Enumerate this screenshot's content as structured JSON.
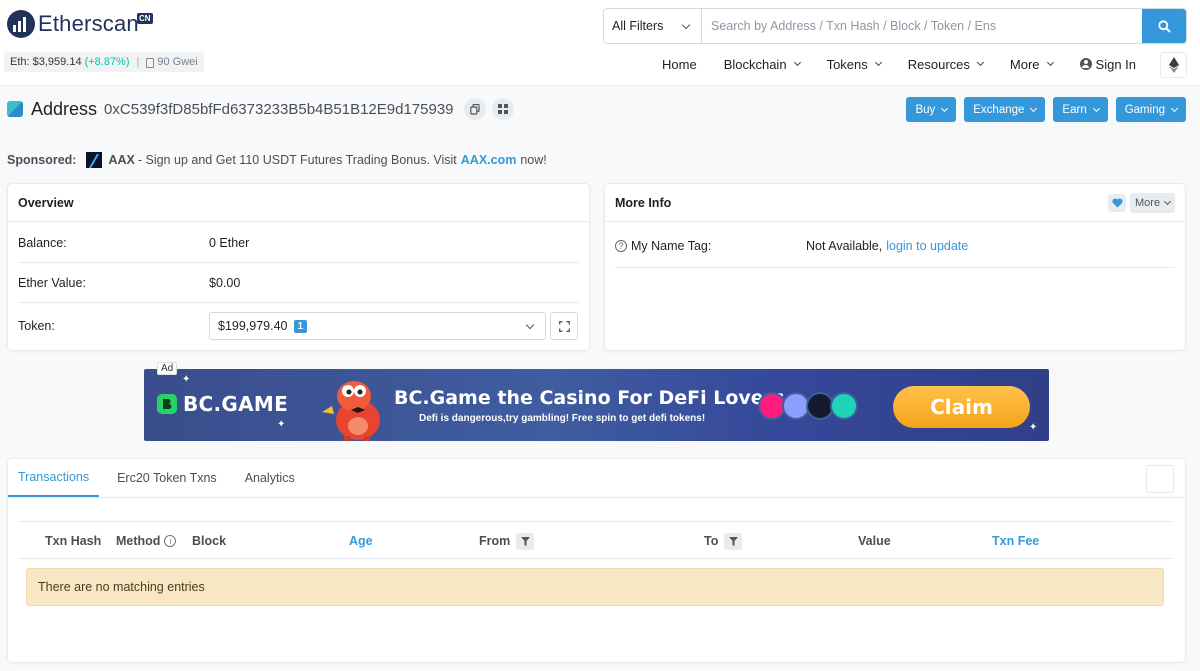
{
  "brand": {
    "name": "Etherscan",
    "cn_badge": "CN"
  },
  "eth_stats": {
    "price": "Eth: $3,959.14",
    "change": "(+8.87%)",
    "separator": "|",
    "gas": "90 Gwei"
  },
  "search": {
    "filter": "All Filters",
    "placeholder": "Search by Address / Txn Hash / Block / Token / Ens"
  },
  "nav": {
    "home": "Home",
    "blockchain": "Blockchain",
    "tokens": "Tokens",
    "resources": "Resources",
    "more": "More",
    "signin": "Sign In"
  },
  "address": {
    "label": "Address",
    "hash": "0xC539f3fD85bfFd6373233B5b4B51B12E9d175939"
  },
  "actions": {
    "buy": "Buy",
    "exchange": "Exchange",
    "earn": "Earn",
    "gaming": "Gaming"
  },
  "sponsored": {
    "label": "Sponsored:",
    "dash": "-",
    "name": "AAX",
    "text": "- Sign up and Get 110 USDT Futures Trading Bonus. Visit",
    "link": "AAX.com",
    "tail": "now!"
  },
  "overview": {
    "title": "Overview",
    "balance_label": "Balance:",
    "balance_value": "0 Ether",
    "ether_value_label": "Ether Value:",
    "ether_value": "$0.00",
    "token_label": "Token:",
    "token_value": "$199,979.40",
    "token_count": "1"
  },
  "more_info": {
    "title": "More Info",
    "more_btn": "More",
    "name_tag_label": "My Name Tag:",
    "name_tag_value": "Not Available,",
    "name_tag_link": "login to update"
  },
  "ad": {
    "tag": "Ad",
    "brand": "BC.GAME",
    "headline": "BC.Game the Casino For DeFi Lovers",
    "sub": "Defi is dangerous,try gambling! Free spin to get defi tokens!",
    "cta": "Claim"
  },
  "tabs": {
    "transactions": "Transactions",
    "erc20": "Erc20 Token Txns",
    "analytics": "Analytics"
  },
  "table": {
    "columns": {
      "hash": "Txn Hash",
      "method": "Method",
      "block": "Block",
      "age": "Age",
      "from": "From",
      "to": "To",
      "value": "Value",
      "fee": "Txn Fee"
    },
    "empty": "There are no matching entries"
  },
  "colors": {
    "primary": "#3498db",
    "positive": "#00c9a7",
    "brand_dark": "#21325b",
    "empty_bg": "#f8e7c4"
  }
}
